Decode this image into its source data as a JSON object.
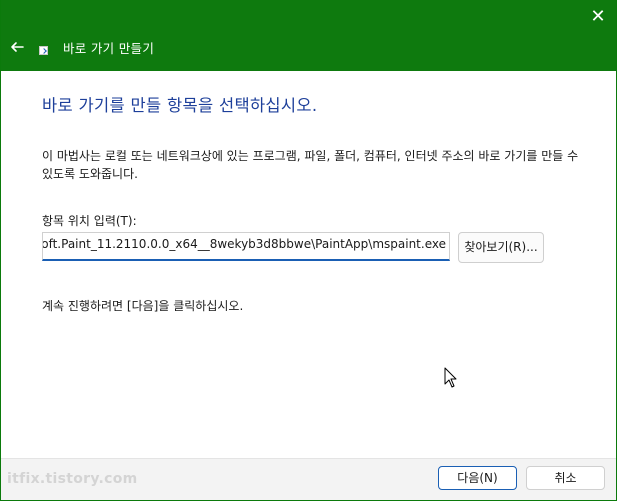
{
  "titlebar": {
    "title": "바로 가기 만들기",
    "accent_color": "#0e7a0e",
    "back_icon": "arrow-left-icon",
    "close_icon": "close-icon",
    "close_glyph": "✕"
  },
  "main": {
    "heading": "바로 가기를 만들 항목을 선택하십시오.",
    "description": "이 마법사는 로컬 또는 네트워크상에 있는 프로그램, 파일, 폴더, 컴퓨터, 인터넷 주소의 바로 가기를 만들 수 있도록 도와줍니다.",
    "location_label": "항목 위치 입력(T):",
    "location_value": "oft.Paint_11.2110.0.0_x64__8wekyb3d8bbwe\\PaintApp\\mspaint.exe",
    "browse_label": "찾아보기(R)...",
    "continue_text": "계속 진행하려면 [다음]을 클릭하십시오."
  },
  "footer": {
    "next_label": "다음(N)",
    "cancel_label": "취소"
  },
  "watermark": "itfix.tistory.com"
}
